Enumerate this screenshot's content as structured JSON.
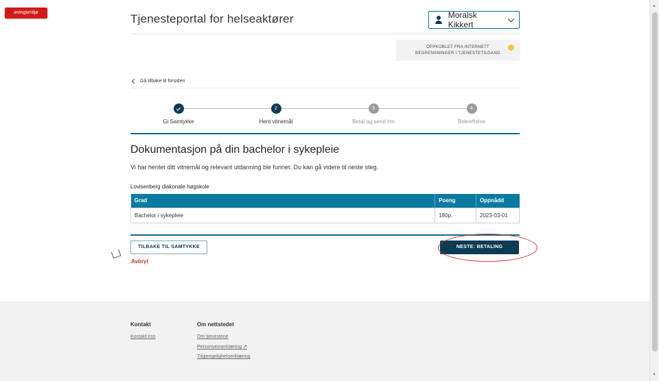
{
  "env_badge": "øvingsmiljø",
  "header": {
    "title": "Tjenesteportal for helseaktører",
    "user_name": "Moralsk Kikkert"
  },
  "status": {
    "line1": "OPPKOBLET FRA INTERNETT",
    "line2": "BEGRENSNINGER I TJENESTETILGANG",
    "indicator_color": "#f5c542"
  },
  "back_link": "Gå tilbake til forsiden",
  "steps": [
    {
      "number": "1",
      "label": "Gi Samtykke",
      "state": "done"
    },
    {
      "number": "2",
      "label": "Hent vitnemål",
      "state": "active"
    },
    {
      "number": "3",
      "label": "Betal og send inn",
      "state": "todo"
    },
    {
      "number": "4",
      "label": "Bekreftelse",
      "state": "todo"
    }
  ],
  "content": {
    "title": "Dokumentasjon på din bachelor i sykepleie",
    "description": "Vi har hentet ditt vitnemål og relevant utdanning ble funnet. Du kan gå videre til neste steg.",
    "school": "Lovisenberg diakonale høgskole",
    "table": {
      "headers": [
        "Grad",
        "Poeng",
        "Oppnådd"
      ],
      "rows": [
        [
          "Bachelor i sykepleie",
          "180p.",
          "2023-03-01"
        ]
      ]
    }
  },
  "actions": {
    "back": "TILBAKE TIL SAMTYKKE",
    "cancel": "Avbryt",
    "next": "NESTE: BETALING"
  },
  "footer": {
    "contact_heading": "Kontakt",
    "contact_link": "Kontakt oss",
    "about_heading": "Om nettstedet",
    "about_links": [
      "Om tjenestene",
      "Personvernerklæring",
      "Tilgjengelighetserklæring"
    ]
  },
  "colors": {
    "primary": "#0b3b55",
    "table_header": "#0b7aa1",
    "danger": "#c0392b",
    "badge": "#d11a1a"
  }
}
